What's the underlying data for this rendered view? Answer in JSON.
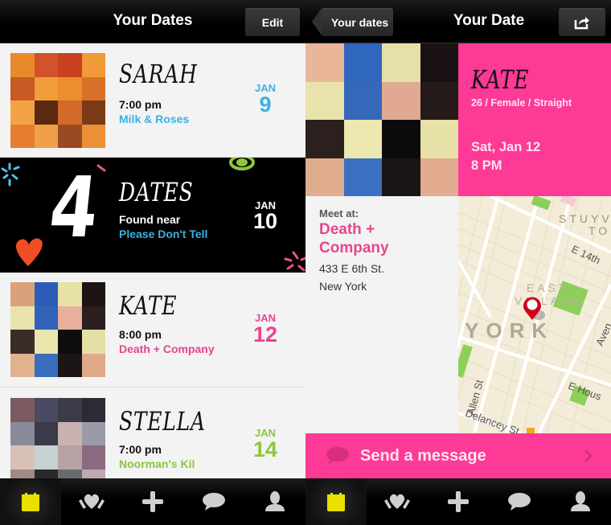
{
  "left_screen": {
    "nav": {
      "title": "Your Dates",
      "edit_label": "Edit"
    },
    "dates": [
      {
        "name": "SARAH",
        "time": "7:00 pm",
        "venue": "Milk & Roses",
        "month": "JAN",
        "day": "9",
        "accent": "#3bb0e6"
      },
      {
        "name": "KATE",
        "time": "8:00 pm",
        "venue": "Death + Company",
        "month": "JAN",
        "day": "12",
        "accent": "#e8458f"
      },
      {
        "name": "STELLA",
        "time": "7:00 pm",
        "venue": "Noorman's Kil",
        "month": "JAN",
        "day": "14",
        "accent": "#8cc63e"
      }
    ],
    "promo": {
      "count": "4",
      "label": "DATES",
      "found_near": "Found near",
      "place": "Please Don't Tell",
      "month": "JAN",
      "day": "10",
      "accent": "#3bb0e6"
    }
  },
  "right_screen": {
    "nav": {
      "back_label": "Your dates",
      "title": "Your Date",
      "share_icon": "share-icon"
    },
    "profile": {
      "name": "KATE",
      "details": "26 / Female / Straight",
      "date": "Sat, Jan 12",
      "time": "8 PM",
      "accent": "#fd3a96"
    },
    "meet": {
      "label": "Meet at:",
      "venue_line1": "Death +",
      "venue_line2": "Company",
      "address": "433 E 6th St.",
      "city": "New York"
    },
    "map": {
      "labels": [
        "STUYV",
        "TO",
        "E 14th",
        "EAST",
        "VILLAGE",
        "YORK",
        "Aven",
        "Allen St",
        "E Hous",
        "Delancey St"
      ]
    },
    "send_message": {
      "label": "Send a message"
    }
  },
  "tab_bar": {
    "tabs": [
      {
        "icon": "calendar-icon",
        "active": true
      },
      {
        "icon": "hearts-icon",
        "active": false
      },
      {
        "icon": "plus-icon",
        "active": false
      },
      {
        "icon": "chat-icon",
        "active": false
      },
      {
        "icon": "profile-icon",
        "active": false
      }
    ],
    "active_color": "#e8e000"
  }
}
